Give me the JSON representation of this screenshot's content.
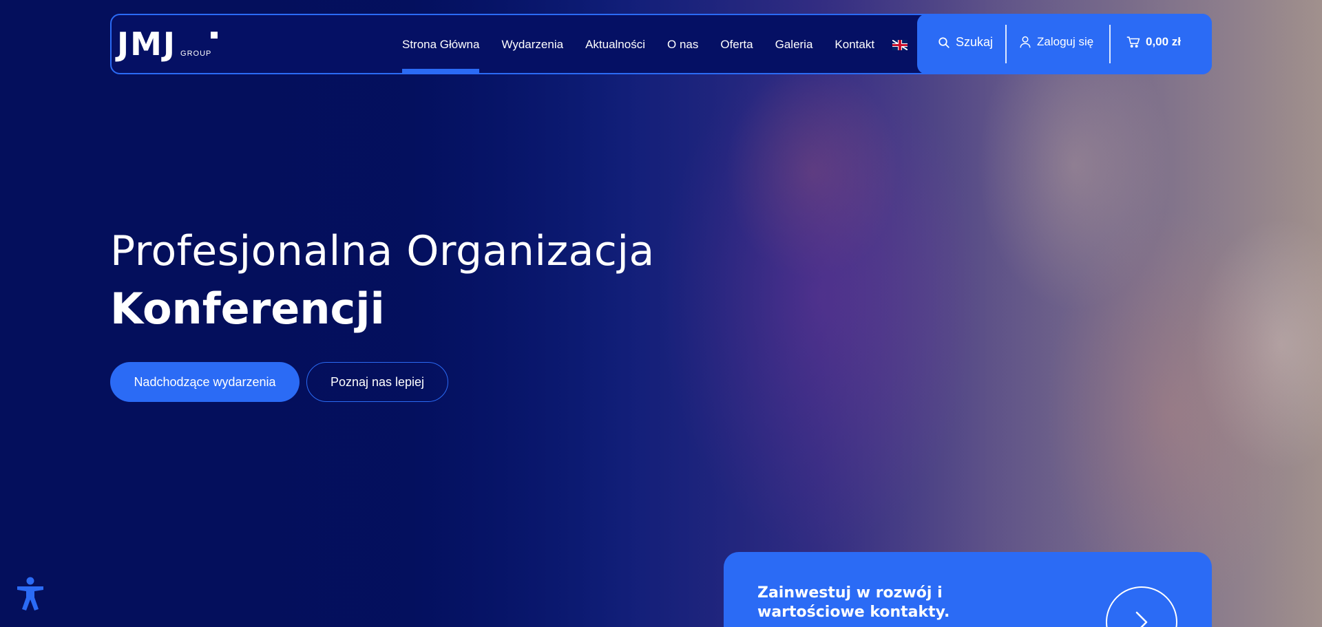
{
  "brand": {
    "logo_text": "JMJ",
    "logo_sub": "GROUP"
  },
  "nav": {
    "items": [
      {
        "label": "Strona Główna",
        "active": true
      },
      {
        "label": "Wydarzenia",
        "active": false
      },
      {
        "label": "Aktualności",
        "active": false
      },
      {
        "label": "O nas",
        "active": false
      },
      {
        "label": "Oferta",
        "active": false
      },
      {
        "label": "Galeria",
        "active": false
      },
      {
        "label": "Kontakt",
        "active": false
      }
    ],
    "language_icon": "uk-flag-icon"
  },
  "actions": {
    "search_label": "Szukaj",
    "login_label": "Zaloguj się",
    "cart_total": "0,00 zł"
  },
  "hero": {
    "title_line1": "Profesjonalna Organizacja",
    "title_line2": "Konferencji",
    "primary_button": "Nadchodzące wydarzenia",
    "secondary_button": "Poznaj nas lepiej"
  },
  "promo": {
    "text": "Zainwestuj w rozwój i wartościowe kontakty."
  },
  "colors": {
    "accent": "#2b6bf5",
    "navy": "#040f5c",
    "text": "#ffffff"
  }
}
